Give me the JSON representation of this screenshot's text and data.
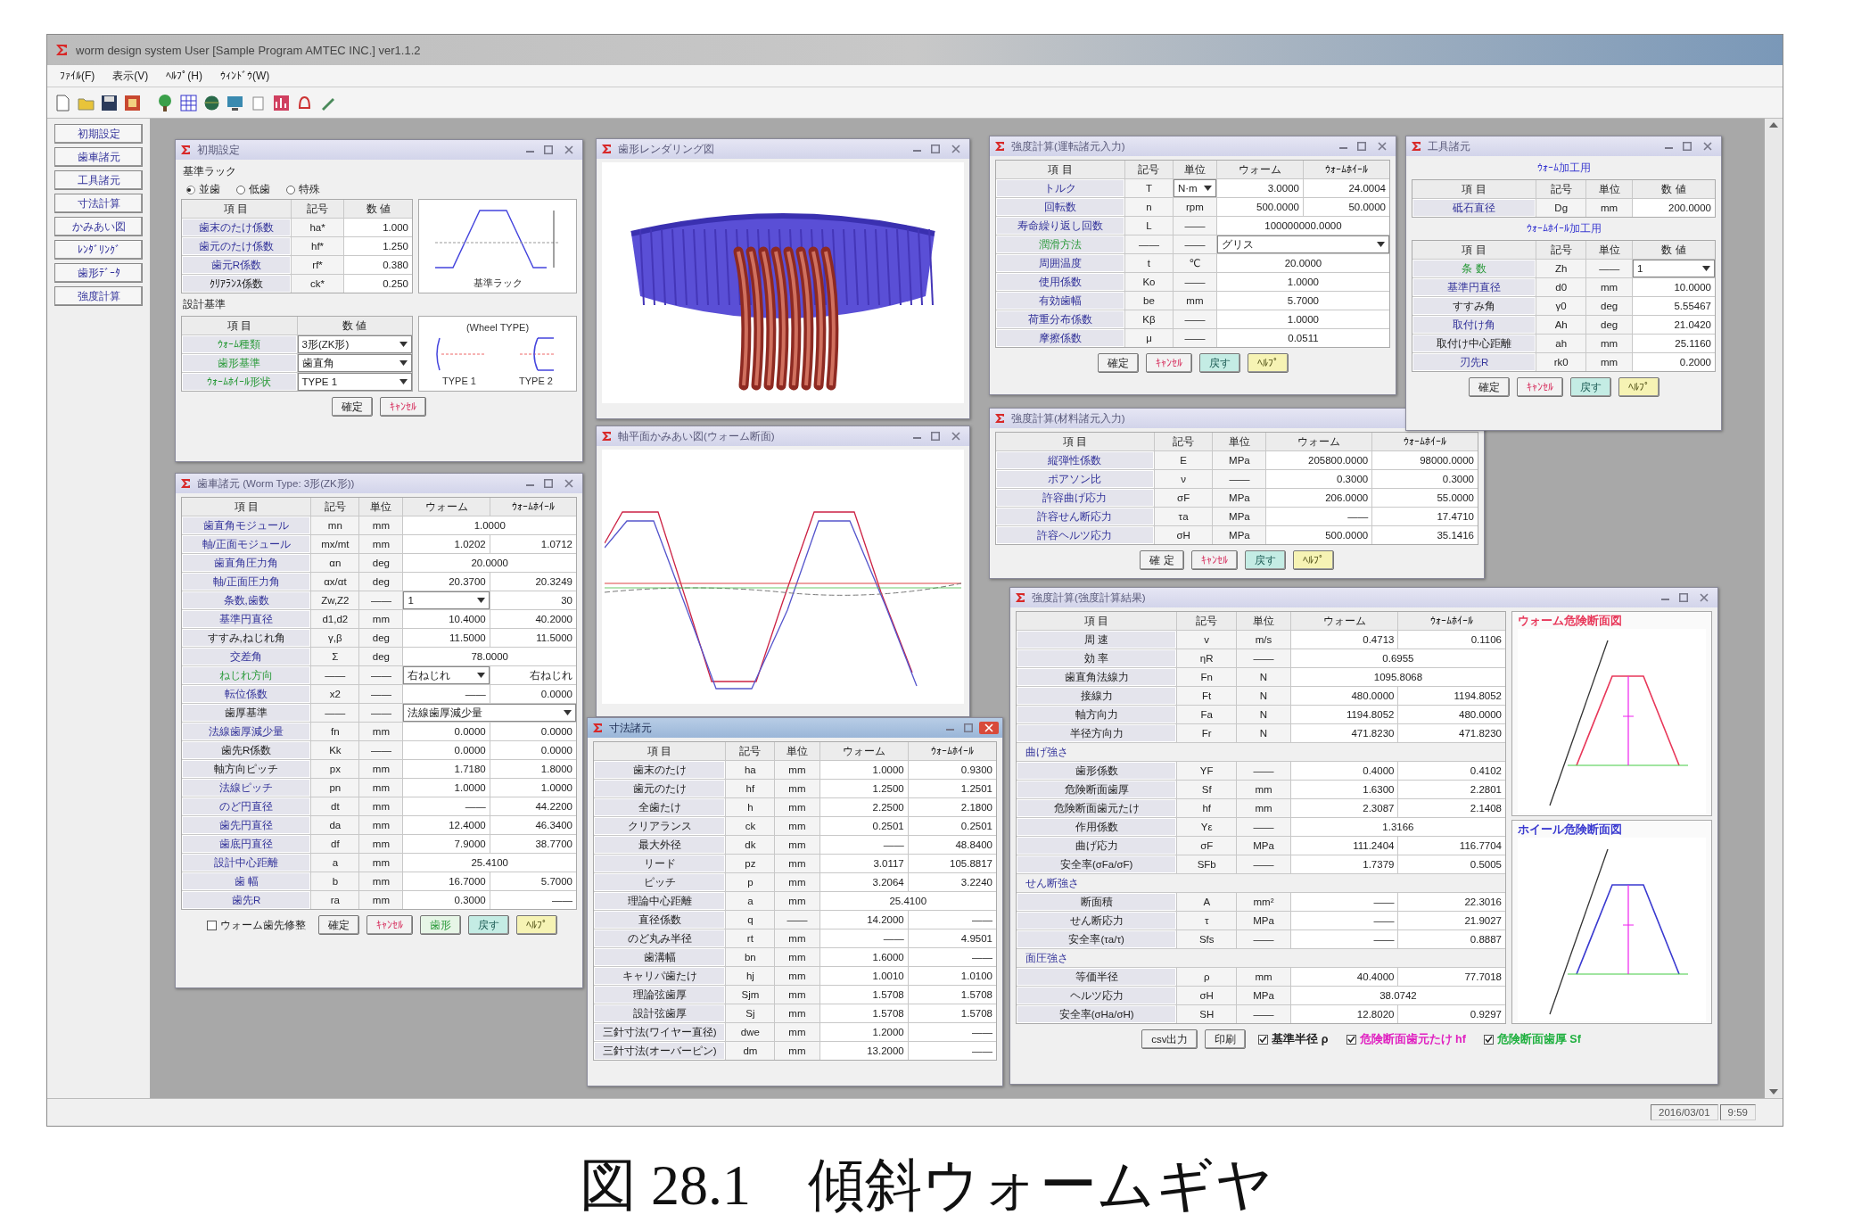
{
  "window": {
    "title": "worm design system User [Sample Program AMTEC INC.] ver1.1.2"
  },
  "menu": [
    {
      "label": "ﾌｧｲﾙ(F)"
    },
    {
      "label": "表示(V)"
    },
    {
      "label": "ﾍﾙﾌﾟ(H)"
    },
    {
      "label": "ｳｨﾝﾄﾞｳ(W)"
    }
  ],
  "sidebar": {
    "items": [
      {
        "label": "初期設定"
      },
      {
        "label": "歯車諸元"
      },
      {
        "label": "工具諸元"
      },
      {
        "label": "寸法計算"
      },
      {
        "label": "かみあい図"
      },
      {
        "label": "ﾚﾝﾀﾞﾘﾝｸﾞ"
      },
      {
        "label": "歯形ﾃﾞｰﾀ"
      },
      {
        "label": "強度計算"
      }
    ]
  },
  "windows": [
    {
      "title": "初期設定",
      "active": false,
      "sections": [
        {
          "kind": "heading",
          "text": "基準ラック"
        },
        {
          "kind": "radios",
          "items": [
            {
              "label": "並歯",
              "selected": true
            },
            {
              "label": "低歯",
              "selected": false
            },
            {
              "label": "特殊",
              "selected": false
            }
          ]
        },
        {
          "kind": "split",
          "parts": [
            {
              "kind": "table",
              "columns": [
                "項 目",
                "記号",
                "数 値"
              ],
              "rows": [
                {
                  "kind": "input",
                  "cells": [
                    "歯末のたけ係数",
                    "ha*",
                    "1.000"
                  ]
                },
                {
                  "kind": "input",
                  "cells": [
                    "歯元のたけ係数",
                    "hf*",
                    "1.250"
                  ]
                },
                {
                  "kind": "input",
                  "cells": [
                    "歯元R係数",
                    "rf*",
                    "0.380"
                  ]
                },
                {
                  "kind": "output",
                  "cells": [
                    "ｸﾘｱﾗﾝｽ係数",
                    "ck*",
                    "0.250"
                  ]
                }
              ]
            },
            {
              "kind": "rack-figure",
              "label": "基準ラック"
            }
          ]
        },
        {
          "kind": "heading",
          "text": "設計基準"
        },
        {
          "kind": "split",
          "parts": [
            {
              "kind": "table",
              "columns": [
                "項 目",
                "数 値"
              ],
              "rows": [
                {
                  "kind": "option",
                  "cells": [
                    "ｳｫｰﾑ種類",
                    {
                      "select": "3形(ZK形)"
                    }
                  ]
                },
                {
                  "kind": "option",
                  "cells": [
                    "歯形基準",
                    {
                      "select": "歯直角"
                    }
                  ]
                },
                {
                  "kind": "option",
                  "cells": [
                    "ｳｫｰﾑﾎｲｰﾙ形状",
                    {
                      "select": "TYPE 1"
                    }
                  ]
                }
              ]
            },
            {
              "kind": "wheel-type-figure",
              "label": "(Wheel TYPE)",
              "labels": [
                "TYPE 1",
                "TYPE 2"
              ]
            }
          ]
        },
        {
          "kind": "bar",
          "items": [
            {
              "kind": "ok",
              "label": "確定"
            },
            {
              "kind": "cancel",
              "label": "ｷｬﾝｾﾙ"
            }
          ]
        }
      ]
    },
    {
      "title": "歯車諸元 (Worm Type: 3形(ZK形))",
      "active": false,
      "sections": [
        {
          "kind": "table",
          "columns": [
            "項 目",
            "記号",
            "単位",
            "ウォーム",
            "ｳｫｰﾑﾎｲｰﾙ"
          ],
          "rows": [
            {
              "kind": "input",
              "cells": [
                "歯直角モジュール",
                "mn",
                "mm",
                {
                  "text": "1.0000"
                }
              ]
            },
            {
              "kind": "input",
              "cells": [
                "軸/正面モジュール",
                "mx/mt",
                "mm",
                "1.0202",
                "1.0712"
              ]
            },
            {
              "kind": "input",
              "cells": [
                "歯直角圧力角",
                "αn",
                "deg",
                {
                  "text": "20.0000"
                }
              ]
            },
            {
              "kind": "input",
              "cells": [
                "軸/正面圧力角",
                "αx/αt",
                "deg",
                "20.3700",
                "20.3249"
              ]
            },
            {
              "kind": "input",
              "cells": [
                "条数,歯数",
                "Zw,Z2",
                "——",
                {
                  "select": "1"
                },
                "30"
              ]
            },
            {
              "kind": "input",
              "cells": [
                "基準円直径",
                "d1,d2",
                "mm",
                "10.4000",
                "40.2000"
              ]
            },
            {
              "kind": "output",
              "cells": [
                "すすみ,ねじれ角",
                "γ,β",
                "deg",
                "11.5000",
                "11.5000"
              ]
            },
            {
              "kind": "input",
              "cells": [
                "交差角",
                "Σ",
                "deg",
                {
                  "text": "78.0000"
                }
              ]
            },
            {
              "kind": "option",
              "cells": [
                "ねじれ方向",
                "——",
                "——",
                {
                  "select": "右ねじれ"
                },
                "右ねじれ"
              ]
            },
            {
              "kind": "input",
              "cells": [
                "転位係数",
                "x2",
                "——",
                "——",
                "0.0000"
              ]
            },
            {
              "kind": "output",
              "cells": [
                "歯厚基準",
                "——",
                "——",
                {
                  "select": "法線歯厚減少量"
                }
              ]
            },
            {
              "kind": "input",
              "cells": [
                "法線歯厚減少量",
                "fn",
                "mm",
                "0.0000",
                "0.0000"
              ]
            },
            {
              "kind": "output",
              "cells": [
                "歯先R係数",
                "Kk",
                "——",
                "0.0000",
                "0.0000"
              ]
            },
            {
              "kind": "output",
              "cells": [
                "軸方向ピッチ",
                "px",
                "mm",
                "1.7180",
                "1.8000"
              ]
            },
            {
              "kind": "input",
              "cells": [
                "法線ピッチ",
                "pn",
                "mm",
                "1.0000",
                "1.0000"
              ]
            },
            {
              "kind": "input",
              "cells": [
                "のど円直径",
                "dt",
                "mm",
                "——",
                "44.2200"
              ]
            },
            {
              "kind": "input",
              "cells": [
                "歯先円直径",
                "da",
                "mm",
                "12.4000",
                "46.3400"
              ]
            },
            {
              "kind": "input",
              "cells": [
                "歯底円直径",
                "df",
                "mm",
                "7.9000",
                "38.7700"
              ]
            },
            {
              "kind": "input",
              "cells": [
                "設計中心距離",
                "a",
                "mm",
                {
                  "text": "25.4100"
                }
              ]
            },
            {
              "kind": "input",
              "cells": [
                "歯 幅",
                "b",
                "mm",
                "16.7000",
                "5.7000"
              ]
            },
            {
              "kind": "input",
              "cells": [
                "歯先R",
                "ra",
                "mm",
                "0.3000",
                "——"
              ]
            }
          ]
        },
        {
          "kind": "bar",
          "items": [
            {
              "kind": "checkbox",
              "label": "ウォーム歯先修整",
              "checked": false
            },
            {
              "kind": "ok",
              "label": "確定"
            },
            {
              "kind": "cancel",
              "label": "ｷｬﾝｾﾙ"
            },
            {
              "kind": "aux",
              "label": "歯形"
            },
            {
              "kind": "undo",
              "label": "戻す"
            },
            {
              "kind": "help",
              "label": "ﾍﾙﾌﾟ"
            }
          ]
        }
      ]
    },
    {
      "title": "歯形レンダリング図",
      "active": false,
      "sections": [
        {
          "kind": "render"
        }
      ]
    },
    {
      "title": "軸平面かみあい図(ウォーム断面)",
      "active": false,
      "sections": [
        {
          "kind": "chart"
        }
      ]
    },
    {
      "title": "寸法諸元",
      "active": true,
      "sections": [
        {
          "kind": "table",
          "columns": [
            "項 目",
            "記号",
            "単位",
            "ウォーム",
            "ｳｫｰﾑﾎｲｰﾙ"
          ],
          "rows": [
            {
              "kind": "output",
              "cells": [
                "歯末のたけ",
                "ha",
                "mm",
                "1.0000",
                "0.9300"
              ]
            },
            {
              "kind": "output",
              "cells": [
                "歯元のたけ",
                "hf",
                "mm",
                "1.2500",
                "1.2501"
              ]
            },
            {
              "kind": "output",
              "cells": [
                "全歯たけ",
                "h",
                "mm",
                "2.2500",
                "2.1800"
              ]
            },
            {
              "kind": "output",
              "cells": [
                "クリアランス",
                "ck",
                "mm",
                "0.2501",
                "0.2501"
              ]
            },
            {
              "kind": "output",
              "cells": [
                "最大外径",
                "dk",
                "mm",
                "——",
                "48.8400"
              ]
            },
            {
              "kind": "output",
              "cells": [
                "リード",
                "pz",
                "mm",
                "3.0117",
                "105.8817"
              ]
            },
            {
              "kind": "output",
              "cells": [
                "ピッチ",
                "p",
                "mm",
                "3.2064",
                "3.2240"
              ]
            },
            {
              "kind": "output",
              "cells": [
                "理論中心距離",
                "a",
                "mm",
                {
                  "text": "25.4100"
                }
              ]
            },
            {
              "kind": "output",
              "cells": [
                "直径係数",
                "q",
                "——",
                "14.2000",
                "——"
              ]
            },
            {
              "kind": "output",
              "cells": [
                "のど丸み半径",
                "rt",
                "mm",
                "——",
                "4.9501"
              ]
            },
            {
              "kind": "output",
              "cells": [
                "歯溝幅",
                "bn",
                "mm",
                "1.6000",
                "——"
              ]
            },
            {
              "kind": "output",
              "cells": [
                "キャリパ歯たけ",
                "hj",
                "mm",
                "1.0010",
                "1.0100"
              ]
            },
            {
              "kind": "output",
              "cells": [
                "理論弦歯厚",
                "Sjm",
                "mm",
                "1.5708",
                "1.5708"
              ]
            },
            {
              "kind": "output",
              "cells": [
                "設計弦歯厚",
                "Sj",
                "mm",
                "1.5708",
                "1.5708"
              ]
            },
            {
              "kind": "output",
              "cells": [
                "三針寸法(ワイヤー直径)",
                "dwe",
                "mm",
                "1.2000",
                "——"
              ]
            },
            {
              "kind": "output",
              "cells": [
                "三針寸法(オーバーピン)",
                "dm",
                "mm",
                "13.2000",
                "——"
              ]
            }
          ]
        }
      ]
    },
    {
      "title": "強度計算(運転諸元入力)",
      "active": false,
      "sections": [
        {
          "kind": "table",
          "columns": [
            "項 目",
            "記号",
            "単位",
            "ウォーム",
            "ｳｫｰﾑﾎｲｰﾙ"
          ],
          "rows": [
            {
              "kind": "input",
              "cells": [
                "トルク",
                "T",
                {
                  "select": "N·m"
                },
                "3.0000",
                "24.0004"
              ]
            },
            {
              "kind": "input",
              "cells": [
                "回転数",
                "n",
                "rpm",
                "500.0000",
                "50.0000"
              ]
            },
            {
              "kind": "input",
              "cells": [
                "寿命繰り返し回数",
                "L",
                "——",
                {
                  "text": "100000000.0000"
                }
              ]
            },
            {
              "kind": "option",
              "cells": [
                "潤滑方法",
                "——",
                "——",
                {
                  "select": "グリス"
                }
              ]
            },
            {
              "kind": "input",
              "cells": [
                "周囲温度",
                "t",
                "℃",
                {
                  "text": "20.0000"
                }
              ]
            },
            {
              "kind": "input",
              "cells": [
                "使用係数",
                "Ko",
                "——",
                {
                  "text": "1.0000"
                }
              ]
            },
            {
              "kind": "input",
              "cells": [
                "有効歯幅",
                "be",
                "mm",
                {
                  "text": "5.7000"
                }
              ]
            },
            {
              "kind": "input",
              "cells": [
                "荷重分布係数",
                "Kβ",
                "——",
                {
                  "text": "1.0000"
                }
              ]
            },
            {
              "kind": "input",
              "cells": [
                "摩擦係数",
                "μ",
                "——",
                {
                  "text": "0.0511"
                }
              ]
            }
          ]
        },
        {
          "kind": "bar",
          "items": [
            {
              "kind": "ok",
              "label": "確定"
            },
            {
              "kind": "cancel",
              "label": "ｷｬﾝｾﾙ"
            },
            {
              "kind": "undo",
              "label": "戻す"
            },
            {
              "kind": "help",
              "label": "ﾍﾙﾌﾟ"
            }
          ]
        }
      ]
    },
    {
      "title": "工具諸元",
      "active": false,
      "sections": [
        {
          "kind": "subheading",
          "text": "ｳｫｰﾑ加工用"
        },
        {
          "kind": "table",
          "columns": [
            "項 目",
            "記号",
            "単位",
            "数 値"
          ],
          "rows": [
            {
              "kind": "input",
              "cells": [
                "砥石直径",
                "Dg",
                "mm",
                "200.0000"
              ]
            }
          ]
        },
        {
          "kind": "subheading",
          "text": "ｳｫｰﾑﾎｲｰﾙ加工用"
        },
        {
          "kind": "table",
          "columns": [
            "項 目",
            "記号",
            "単位",
            "数 値"
          ],
          "rows": [
            {
              "kind": "option",
              "cells": [
                "条 数",
                "Zh",
                "——",
                {
                  "select": "1"
                }
              ]
            },
            {
              "kind": "input",
              "cells": [
                "基準円直径",
                "d0",
                "mm",
                "10.0000"
              ]
            },
            {
              "kind": "output",
              "cells": [
                "すすみ角",
                "γ0",
                "deg",
                "5.55467"
              ]
            },
            {
              "kind": "input",
              "cells": [
                "取付け角",
                "Ah",
                "deg",
                "21.0420"
              ]
            },
            {
              "kind": "output",
              "cells": [
                "取付け中心距離",
                "ah",
                "mm",
                "25.1160"
              ]
            },
            {
              "kind": "input",
              "cells": [
                "刃先R",
                "rk0",
                "mm",
                "0.2000"
              ]
            }
          ]
        },
        {
          "kind": "bar",
          "items": [
            {
              "kind": "ok",
              "label": "確定"
            },
            {
              "kind": "cancel",
              "label": "ｷｬﾝｾﾙ"
            },
            {
              "kind": "undo",
              "label": "戻す"
            },
            {
              "kind": "help",
              "label": "ﾍﾙﾌﾟ"
            }
          ]
        }
      ]
    },
    {
      "title": "強度計算(材料諸元入力)",
      "active": false,
      "sections": [
        {
          "kind": "table",
          "columns": [
            "項 目",
            "記号",
            "単位",
            "ウォーム",
            "ｳｫｰﾑﾎｲｰﾙ"
          ],
          "rows": [
            {
              "kind": "input",
              "cells": [
                "縦弾性係数",
                "E",
                "MPa",
                "205800.0000",
                "98000.0000"
              ]
            },
            {
              "kind": "input",
              "cells": [
                "ポアソン比",
                "ν",
                "——",
                "0.3000",
                "0.3000"
              ]
            },
            {
              "kind": "input",
              "cells": [
                "許容曲げ応力",
                "σF",
                "MPa",
                "206.0000",
                "55.0000"
              ]
            },
            {
              "kind": "input",
              "cells": [
                "許容せん断応力",
                "τa",
                "MPa",
                "——",
                "17.4710"
              ]
            },
            {
              "kind": "input",
              "cells": [
                "許容ヘルツ応力",
                "σH",
                "MPa",
                "500.0000",
                "35.1416"
              ]
            }
          ]
        },
        {
          "kind": "bar",
          "items": [
            {
              "kind": "ok",
              "label": "確 定"
            },
            {
              "kind": "cancel",
              "label": "ｷｬﾝｾﾙ"
            },
            {
              "kind": "undo",
              "label": "戻す"
            },
            {
              "kind": "help",
              "label": "ﾍﾙﾌﾟ"
            }
          ]
        }
      ]
    },
    {
      "title": "強度計算(強度計算結果)",
      "active": false,
      "sections": [
        {
          "kind": "split",
          "parts": [
            {
              "kind": "table",
              "columns": [
                "項 目",
                "記号",
                "単位",
                "ウォーム",
                "ｳｫｰﾑﾎｲｰﾙ"
              ],
              "rows": [
                {
                  "kind": "output",
                  "cells": [
                    "周 速",
                    "v",
                    "m/s",
                    "0.4713",
                    "0.1106"
                  ]
                },
                {
                  "kind": "output",
                  "cells": [
                    "効 率",
                    "ηR",
                    "——",
                    {
                      "text": "0.6955"
                    }
                  ]
                },
                {
                  "kind": "output",
                  "cells": [
                    "歯直角法線力",
                    "Fn",
                    "N",
                    {
                      "text": "1095.8068"
                    }
                  ]
                },
                {
                  "kind": "output",
                  "cells": [
                    "接線力",
                    "Ft",
                    "N",
                    "480.0000",
                    "1194.8052"
                  ]
                },
                {
                  "kind": "output",
                  "cells": [
                    "軸方向力",
                    "Fa",
                    "N",
                    "1194.8052",
                    "480.0000"
                  ]
                },
                {
                  "kind": "output",
                  "cells": [
                    "半径方向力",
                    "Fr",
                    "N",
                    "471.8230",
                    "471.8230"
                  ]
                },
                {
                  "kind": "group",
                  "cells": [
                    "曲げ強さ"
                  ]
                },
                {
                  "kind": "output",
                  "cells": [
                    "歯形係数",
                    "YF",
                    "——",
                    "0.4000",
                    "0.4102"
                  ]
                },
                {
                  "kind": "output",
                  "cells": [
                    "危険断面歯厚",
                    "Sf",
                    "mm",
                    "1.6300",
                    "2.2801"
                  ]
                },
                {
                  "kind": "output",
                  "cells": [
                    "危険断面歯元たけ",
                    "hf",
                    "mm",
                    "2.3087",
                    "2.1408"
                  ]
                },
                {
                  "kind": "output",
                  "cells": [
                    "作用係数",
                    "Yε",
                    "——",
                    {
                      "text": "1.3166"
                    }
                  ]
                },
                {
                  "kind": "output",
                  "cells": [
                    "曲げ応力",
                    "σF",
                    "MPa",
                    "111.2404",
                    "116.7704"
                  ]
                },
                {
                  "kind": "output",
                  "cells": [
                    "安全率(σFa/σF)",
                    "SFb",
                    "——",
                    "1.7379",
                    "0.5005"
                  ]
                },
                {
                  "kind": "group",
                  "cells": [
                    "せん断強さ"
                  ]
                },
                {
                  "kind": "output",
                  "cells": [
                    "断面積",
                    "A",
                    "mm²",
                    "——",
                    "22.3016"
                  ]
                },
                {
                  "kind": "output",
                  "cells": [
                    "せん断応力",
                    "τ",
                    "MPa",
                    "——",
                    "21.9027"
                  ]
                },
                {
                  "kind": "output",
                  "cells": [
                    "安全率(τa/τ)",
                    "Sfs",
                    "——",
                    "——",
                    "0.8887"
                  ]
                },
                {
                  "kind": "group",
                  "cells": [
                    "面圧強さ"
                  ]
                },
                {
                  "kind": "output",
                  "cells": [
                    "等価半径",
                    "ρ",
                    "mm",
                    "40.4000",
                    "77.7018"
                  ]
                },
                {
                  "kind": "output",
                  "cells": [
                    "ヘルツ応力",
                    "σH",
                    "MPa",
                    {
                      "text": "38.0742"
                    }
                  ]
                },
                {
                  "kind": "output",
                  "cells": [
                    "安全率(σHa/σH)",
                    "SH",
                    "——",
                    "12.8020",
                    "0.9297"
                  ]
                }
              ]
            },
            {
              "kind": "figures",
              "items": [
                {
                  "title": "ウォーム危険断面図",
                  "color": "#e8385a"
                },
                {
                  "title": "ホイール危険断面図",
                  "color": "#3a3ad0"
                }
              ]
            }
          ]
        },
        {
          "kind": "bar",
          "items": [
            {
              "kind": "ok",
              "label": "csv出力"
            },
            {
              "kind": "ok",
              "label": "印刷"
            },
            {
              "kind": "checkbox",
              "label": "基準半径 ρ",
              "checked": true,
              "color": "#222222"
            },
            {
              "kind": "checkbox",
              "label": "危険断面歯元たけ hf",
              "checked": true,
              "color": "#e020c0"
            },
            {
              "kind": "checkbox",
              "label": "危険断面歯厚 Sf",
              "checked": true,
              "color": "#20b040"
            }
          ]
        }
      ]
    }
  ],
  "status_bar": {
    "date": "2016/03/01",
    "time": "9:59"
  },
  "caption": "図 28.1　傾斜ウォームギヤ"
}
